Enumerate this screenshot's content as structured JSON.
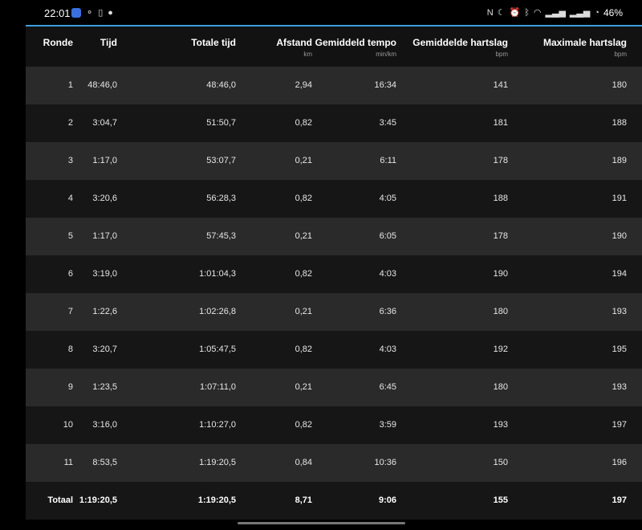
{
  "status_bar": {
    "time": "22:01",
    "battery": "46%",
    "left_icons": [
      "calendar-icon",
      "interaction-icon",
      "battery-saver-icon",
      "location-icon"
    ],
    "right_icons": [
      "nfc-icon",
      "do-not-disturb-icon",
      "alarm-icon",
      "bluetooth-icon",
      "wifi-icon",
      "signal-icon",
      "signal-icon",
      "battery-icon"
    ]
  },
  "table": {
    "columns": [
      {
        "label": "Ronde",
        "unit": ""
      },
      {
        "label": "Tijd",
        "unit": ""
      },
      {
        "label": "Totale tijd",
        "unit": ""
      },
      {
        "label": "Afstand",
        "unit": "km"
      },
      {
        "label": "Gemiddeld tempo",
        "unit": "min/km"
      },
      {
        "label": "Gemiddelde hartslag",
        "unit": "bpm"
      },
      {
        "label": "Maximale hartslag",
        "unit": "bpm"
      }
    ],
    "rows": [
      [
        "1",
        "48:46,0",
        "48:46,0",
        "2,94",
        "16:34",
        "141",
        "180"
      ],
      [
        "2",
        "3:04,7",
        "51:50,7",
        "0,82",
        "3:45",
        "181",
        "188"
      ],
      [
        "3",
        "1:17,0",
        "53:07,7",
        "0,21",
        "6:11",
        "178",
        "189"
      ],
      [
        "4",
        "3:20,6",
        "56:28,3",
        "0,82",
        "4:05",
        "188",
        "191"
      ],
      [
        "5",
        "1:17,0",
        "57:45,3",
        "0,21",
        "6:05",
        "178",
        "190"
      ],
      [
        "6",
        "3:19,0",
        "1:01:04,3",
        "0,82",
        "4:03",
        "190",
        "194"
      ],
      [
        "7",
        "1:22,6",
        "1:02:26,8",
        "0,21",
        "6:36",
        "180",
        "193"
      ],
      [
        "8",
        "3:20,7",
        "1:05:47,5",
        "0,82",
        "4:03",
        "192",
        "195"
      ],
      [
        "9",
        "1:23,5",
        "1:07:11,0",
        "0,21",
        "6:45",
        "180",
        "193"
      ],
      [
        "10",
        "3:16,0",
        "1:10:27,0",
        "0,82",
        "3:59",
        "193",
        "197"
      ],
      [
        "11",
        "8:53,5",
        "1:19:20,5",
        "0,84",
        "10:36",
        "150",
        "196"
      ]
    ],
    "total": [
      "Totaal",
      "1:19:20,5",
      "1:19:20,5",
      "8,71",
      "9:06",
      "155",
      "197"
    ]
  },
  "colors": {
    "accent": "#3aa0dc",
    "row_odd": "#2a2a2a",
    "row_even": "#161616",
    "background": "#121212"
  }
}
